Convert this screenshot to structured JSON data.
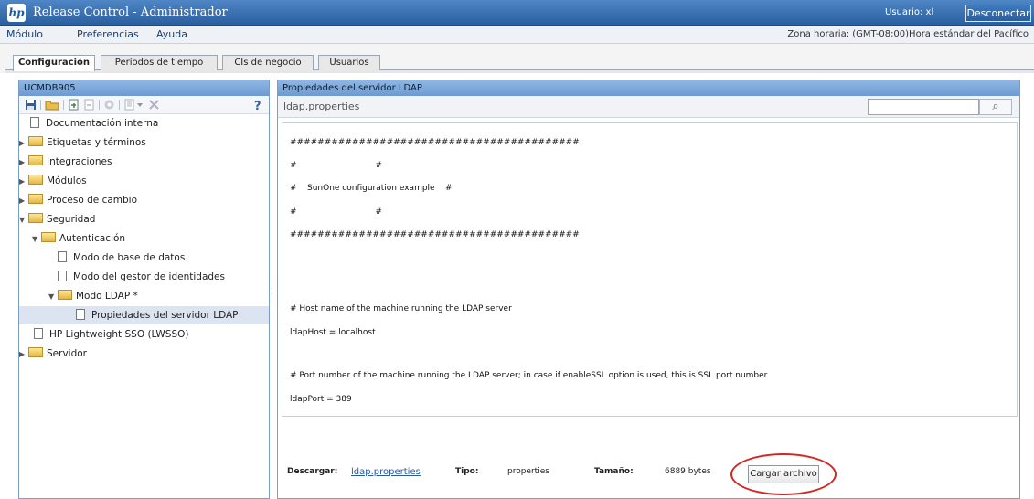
{
  "titlebar": {
    "logo": "hp",
    "title": "Release Control - Administrador",
    "user": "Usuario: xl",
    "disconnect": "Desconectar"
  },
  "menubar": {
    "items": [
      "Módulo",
      "Preferencias",
      "Ayuda"
    ],
    "timezone": "Zona horaria: (GMT-08:00)Hora estándar del Pacífico"
  },
  "tabs": [
    {
      "label": "Configuración",
      "active": true
    },
    {
      "label": "Períodos de tiempo",
      "active": false
    },
    {
      "label": "CIs de negocio",
      "active": false
    },
    {
      "label": "Usuarios",
      "active": false
    }
  ],
  "left_panel": {
    "header": "UCMDB905",
    "help": "?",
    "toolbar_icons": [
      "save-icon",
      "new-folder-icon",
      "import-icon",
      "export-icon",
      "settings-icon",
      "new-item-icon",
      "dropdown-icon",
      "delete-icon",
      "help-icon"
    ],
    "tree": [
      {
        "label": "Documentación interna",
        "type": "doc",
        "level": 0,
        "expanded": null
      },
      {
        "label": "Etiquetas y términos",
        "type": "folder",
        "level": 0,
        "expanded": false
      },
      {
        "label": "Integraciones",
        "type": "folder",
        "level": 0,
        "expanded": false
      },
      {
        "label": "Módulos",
        "type": "folder",
        "level": 0,
        "expanded": false
      },
      {
        "label": "Proceso de cambio",
        "type": "folder",
        "level": 0,
        "expanded": false
      },
      {
        "label": "Seguridad",
        "type": "folder",
        "level": 0,
        "expanded": true
      },
      {
        "label": "Autenticación",
        "type": "folder",
        "level": 1,
        "expanded": true
      },
      {
        "label": "Modo de base de datos",
        "type": "doc",
        "level": 2,
        "expanded": null
      },
      {
        "label": "Modo del gestor de identidades",
        "type": "doc",
        "level": 2,
        "expanded": null
      },
      {
        "label": "Modo LDAP *",
        "type": "folder",
        "level": 2,
        "expanded": true
      },
      {
        "label": "Propiedades del servidor LDAP",
        "type": "doc",
        "level": 3,
        "expanded": null,
        "selected": true
      },
      {
        "label": "HP Lightweight SSO (LWSSO)",
        "type": "doc",
        "level": 1,
        "expanded": null
      },
      {
        "label": "Servidor",
        "type": "folder",
        "level": 0,
        "expanded": false
      }
    ]
  },
  "right_panel": {
    "header": "Propiedades del servidor LDAP",
    "filename": "ldap.properties",
    "search_value": "",
    "content_lines": [
      "##########################################",
      "#                              #",
      "#    SunOne configuration example    #",
      "#                              #",
      "##########################################",
      "# Host name of the machine running the LDAP server",
      "ldapHost = localhost",
      "# Port number of the machine running the LDAP server; in case if enableSSL option is used, this is SSL port number",
      "ldapPort = 389"
    ],
    "footer": {
      "download_label": "Descargar:",
      "download_link": "ldap.properties",
      "type_label": "Tipo:",
      "type_value": "properties",
      "size_label": "Tamaño:",
      "size_value": "6889 bytes",
      "upload_button": "Cargar archivo"
    }
  },
  "colors": {
    "titlebar": "#2a5fa0",
    "panel_header": "#7ea8da",
    "highlight_ring": "#d62424",
    "link": "#2a5aa0"
  }
}
